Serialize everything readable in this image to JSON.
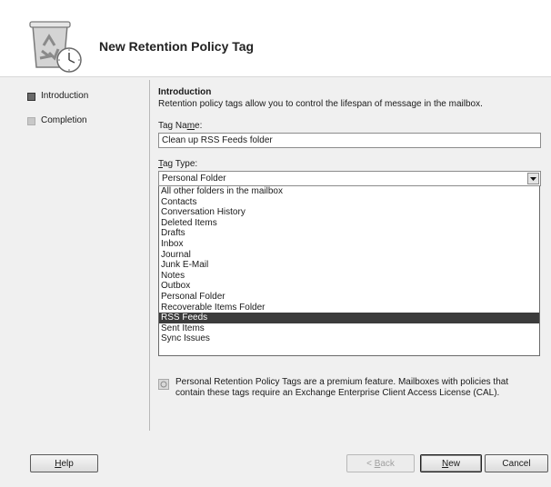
{
  "window": {
    "title": "New Retention Policy Tag"
  },
  "nav": {
    "items": [
      {
        "label": "Introduction",
        "active": true
      },
      {
        "label": "Completion",
        "active": false
      }
    ]
  },
  "intro": {
    "title": "Introduction",
    "description": "Retention policy tags allow you to control the lifespan of message in the mailbox."
  },
  "tag_name": {
    "label_before": "Tag Na",
    "label_underlined": "m",
    "label_after": "e:",
    "value": "Clean up RSS Feeds folder"
  },
  "tag_type": {
    "label_underlined": "T",
    "label_after": "ag Type:",
    "selected": "Personal Folder",
    "options": [
      "All other folders in the mailbox",
      "Contacts",
      "Conversation History",
      "Deleted Items",
      "Drafts",
      "Inbox",
      "Journal",
      "Junk E-Mail",
      "Notes",
      "Outbox",
      "Personal Folder",
      "Recoverable Items Folder",
      "RSS Feeds",
      "Sent Items",
      "Sync Issues"
    ],
    "highlighted_option": "RSS Feeds"
  },
  "note": {
    "text": "Personal Retention Policy Tags are a premium feature. Mailboxes with policies that contain these tags require an Exchange Enterprise Client Access License (CAL)."
  },
  "buttons": {
    "help_underlined": "H",
    "help_rest": "elp",
    "back_prefix": "< ",
    "back_underlined": "B",
    "back_rest": "ack",
    "new_underlined": "N",
    "new_rest": "ew",
    "cancel": "Cancel"
  },
  "icons": {
    "wizard": "recycle-clock-icon",
    "dropdown": "chevron-down-icon",
    "note": "info-icon"
  },
  "colors": {
    "selection": "#3c3c3c",
    "active_nav": "#6a6a6a"
  }
}
